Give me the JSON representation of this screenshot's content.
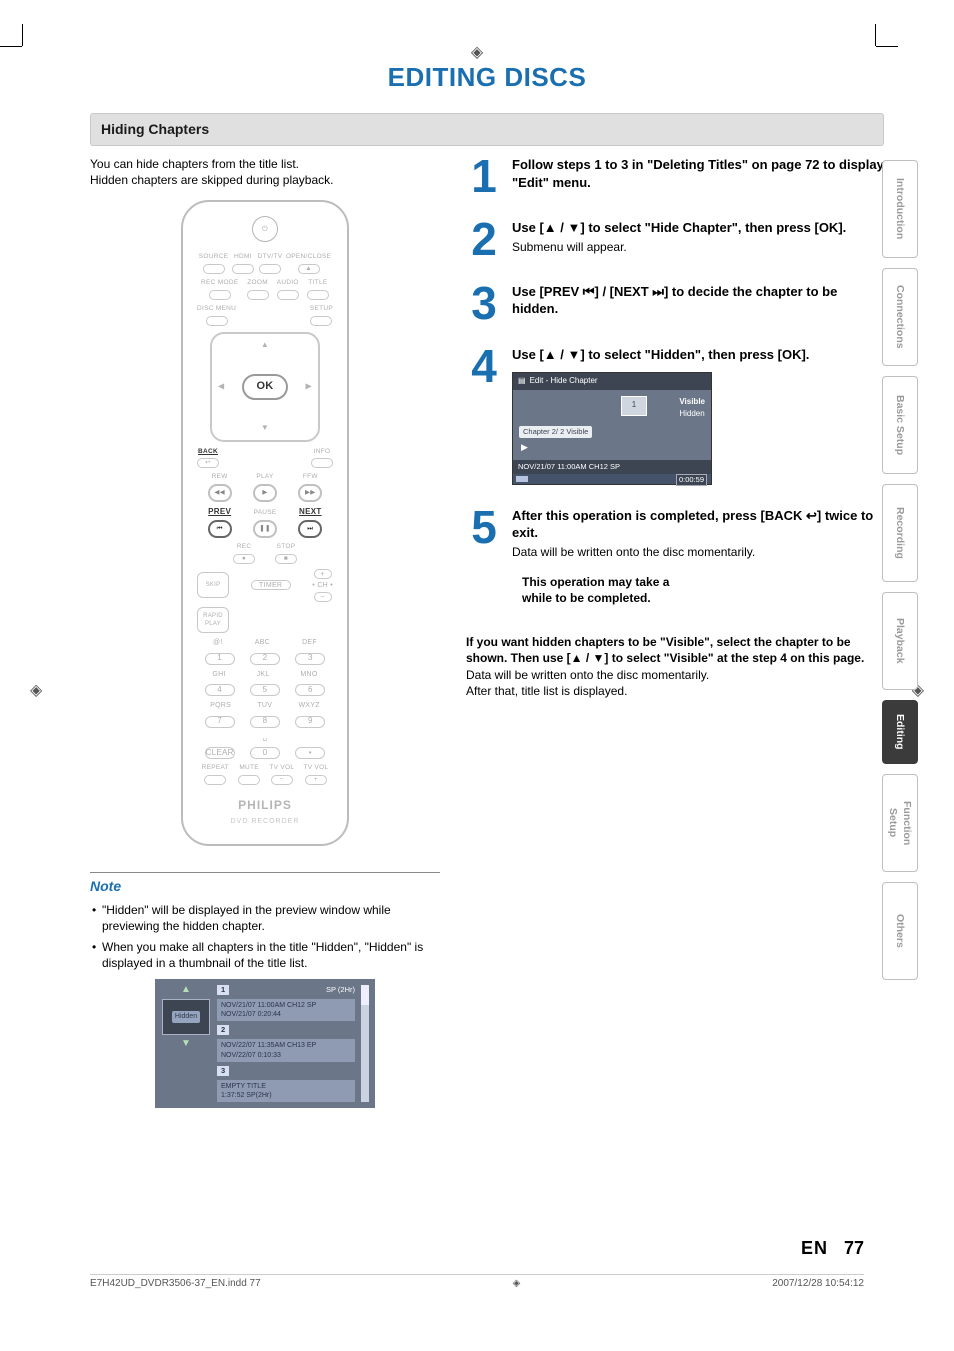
{
  "title": "EDITING DISCS",
  "section": "Hiding Chapters",
  "intro_line1": "You can hide chapters from the title list.",
  "intro_line2": "Hidden chapters are skipped during playback.",
  "remote": {
    "ok": "OK",
    "back": "BACK",
    "info": "INFO",
    "play": "PLAY",
    "rew": "REW",
    "ffw": "FFW",
    "prev": "PREV",
    "pause": "PAUSE",
    "next": "NEXT",
    "rec": "REC",
    "stop": "STOP",
    "skip": "SKIP",
    "timer": "TIMER",
    "rapid": "RAPID PLAY",
    "ch_plus": "+",
    "ch_label": "• CH •",
    "ch_minus": "−",
    "source": "SOURCE",
    "hdmi": "HDMI",
    "dtvtv": "DTV/TV",
    "openclose": "OPEN/CLOSE",
    "recmode": "REC MODE",
    "zoom": "ZOOM",
    "audio": "AUDIO",
    "title": "TITLE",
    "discmenu": "DISC MENU",
    "setup": "SETUP",
    "at": "@!",
    "abc": "ABC",
    "def": "DEF",
    "ghi": "GHI",
    "jkl": "JKL",
    "mno": "MNO",
    "pqrs": "PQRS",
    "tuv": "TUV",
    "wxyz": "WXYZ",
    "clear": "CLEAR",
    "repeat": "REPEAT",
    "mute": "MUTE",
    "tvvol": "TV VOL",
    "brand": "PHILIPS",
    "brand_sub": "DVD RECORDER",
    "nums": [
      "1",
      "2",
      "3",
      "4",
      "5",
      "6",
      "7",
      "8",
      "9",
      "0"
    ],
    "space": "␣",
    "dot": "•"
  },
  "steps": [
    {
      "n": "1",
      "lead": "Follow steps 1 to 3 in \"Deleting Titles\" on page 72 to display \"Edit\" menu."
    },
    {
      "n": "2",
      "lead_pre": "Use [",
      "lead_mid": " / ",
      "lead_post": "] to select \"Hide Chapter\", then press [OK].",
      "sub": "Submenu will appear."
    },
    {
      "n": "3",
      "lead": "Use [PREV ⏮] / [NEXT ⏭] to decide the chapter to be hidden."
    },
    {
      "n": "4",
      "lead_pre": "Use [",
      "lead_mid": " / ",
      "lead_post": "] to select \"Hidden\", then press [OK]."
    },
    {
      "n": "5",
      "lead": "After this operation is completed, press [BACK ↩] twice to exit.",
      "sub": "Data will be written onto the disc momentarily."
    }
  ],
  "edit_panel": {
    "head": "Edit - Hide Chapter",
    "menu_visible": "Visible",
    "menu_hidden": "Hidden",
    "chapter_info": "Chapter    2/  2    Visible",
    "foot_left": "NOV/21/07 11:00AM CH12 SP",
    "time": "0:00:59",
    "preview_badge": "1"
  },
  "op_note": "This operation may take a while to be completed.",
  "visible_bold": "If you want hidden chapters to be \"Visible\", select the chapter to be shown. Then use [▲ / ▼] to select \"Visible\" at the step 4 on this page.",
  "visible_rest1": "Data will be written onto the disc momentarily.",
  "visible_rest2": "After that, title list is displayed.",
  "note": {
    "heading": "Note",
    "items": [
      "\"Hidden\" will be displayed in the preview window while previewing the hidden chapter.",
      "When you make all chapters in the title \"Hidden\", \"Hidden\" is displayed in a thumbnail of the title list."
    ]
  },
  "title_list": {
    "badge": "Hidden",
    "top_right": "SP (2Hr)",
    "rows": [
      {
        "n": "1",
        "l1": "NOV/21/07  11:00AM CH12  SP",
        "l2": "NOV/21/07   0:20:44"
      },
      {
        "n": "2",
        "l1": "NOV/22/07  11:35AM CH13  EP",
        "l2": "NOV/22/07   0:10:33"
      },
      {
        "n": "3",
        "l1": "EMPTY TITLE",
        "l2": "1:37:52  SP(2Hr)"
      }
    ]
  },
  "tabs": [
    "Introduction",
    "Connections",
    "Basic Setup",
    "Recording",
    "Playback",
    "Editing",
    "Function Setup",
    "Others"
  ],
  "active_tab": "Editing",
  "footer": {
    "lang": "EN",
    "page": "77"
  },
  "meta": {
    "file": "E7H42UD_DVDR3506-37_EN.indd   77",
    "ts": "2007/12/28   10:54:12"
  }
}
